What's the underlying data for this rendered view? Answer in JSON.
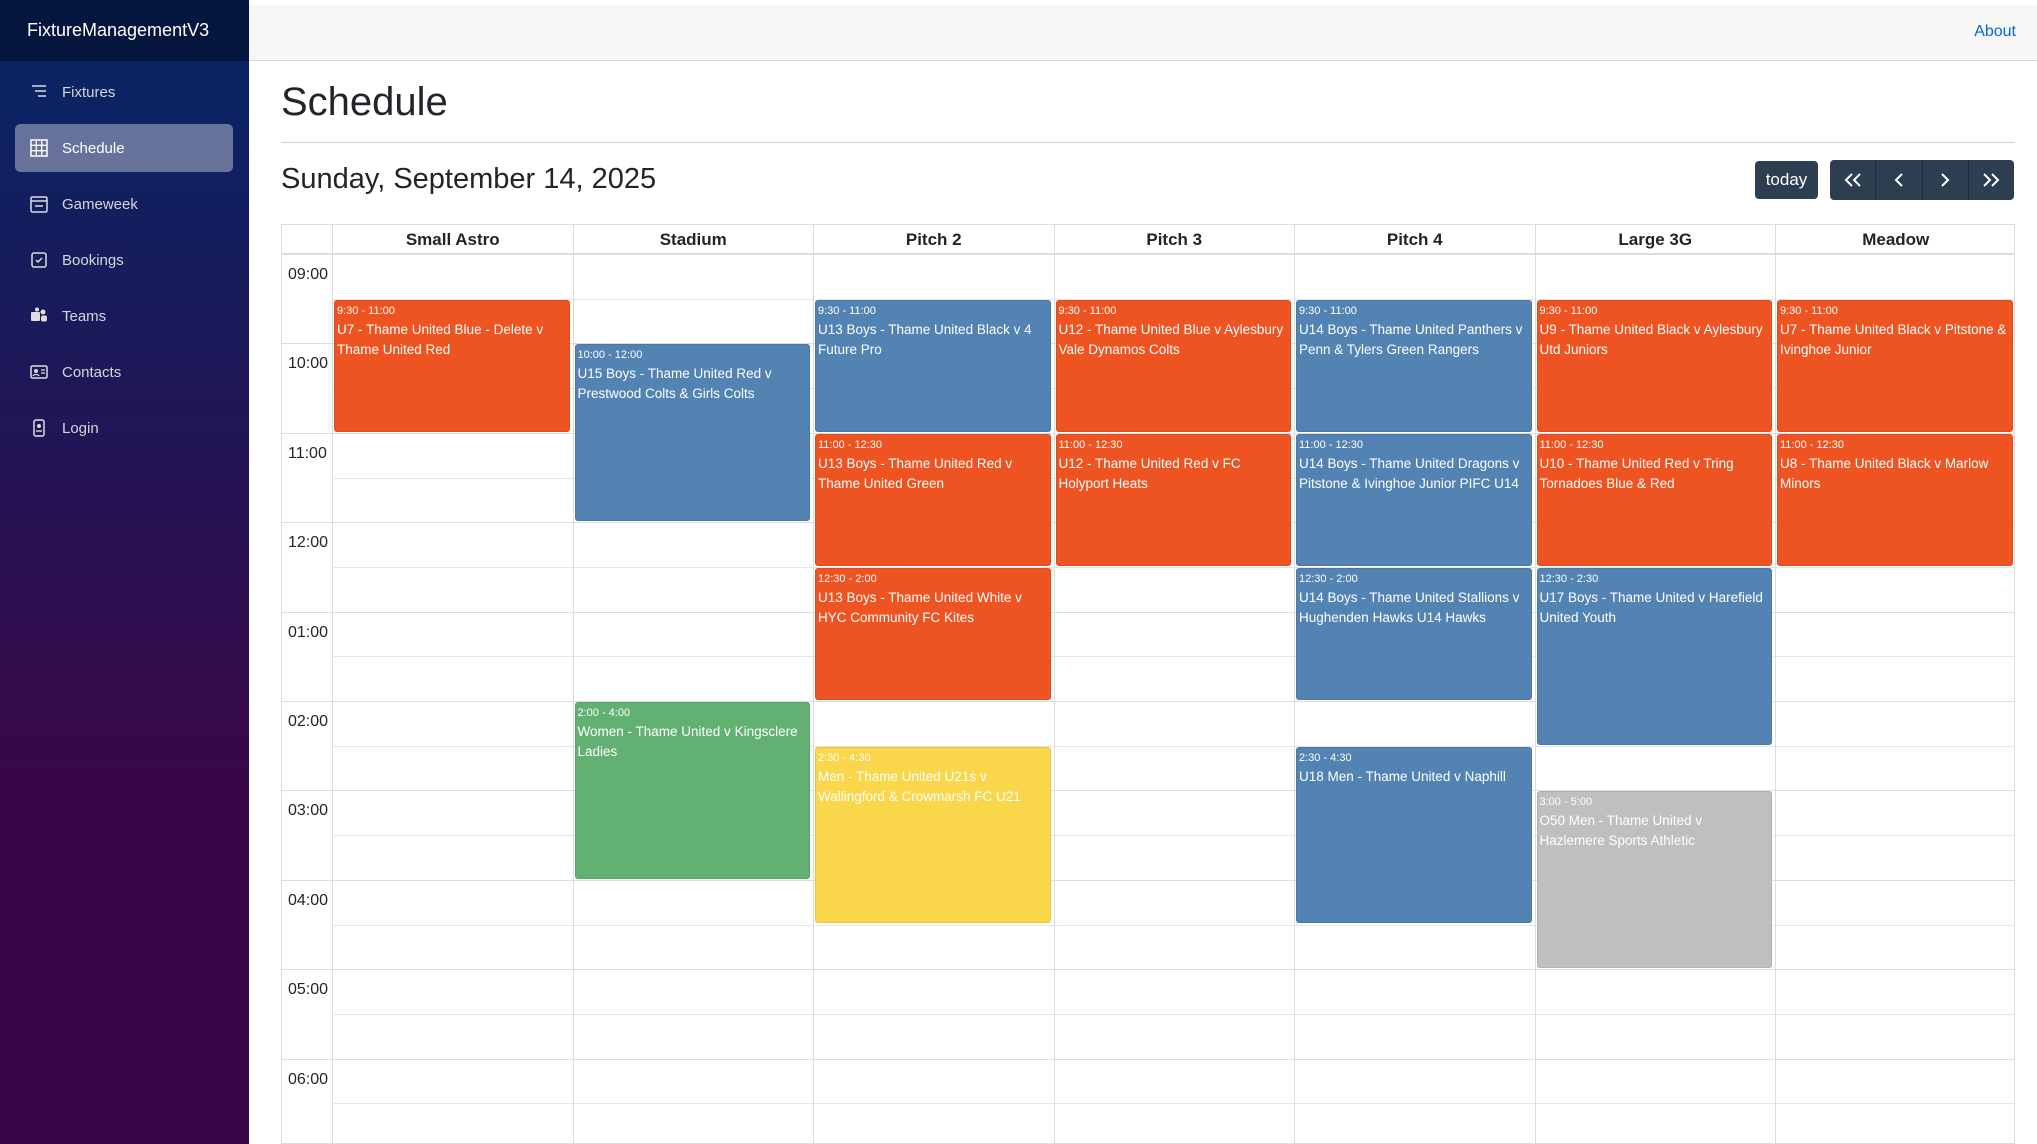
{
  "app": {
    "brand": "FixtureManagementV3"
  },
  "topbar": {
    "about_label": "About"
  },
  "sidebar": {
    "items": [
      {
        "label": "Fixtures",
        "icon": "list-icon"
      },
      {
        "label": "Schedule",
        "icon": "grid-icon",
        "active": true
      },
      {
        "label": "Gameweek",
        "icon": "calendar-check-icon"
      },
      {
        "label": "Bookings",
        "icon": "checkbox-icon"
      },
      {
        "label": "Teams",
        "icon": "teams-icon"
      },
      {
        "label": "Contacts",
        "icon": "contact-card-icon"
      },
      {
        "label": "Login",
        "icon": "login-icon"
      }
    ]
  },
  "page": {
    "title": "Schedule",
    "date": "Sunday, September 14, 2025"
  },
  "toolbar": {
    "today_label": "today",
    "prev_prev": "«",
    "prev": "‹",
    "next": "›",
    "next_next": "»"
  },
  "calendar": {
    "resources": [
      "Small Astro",
      "Stadium",
      "Pitch 2",
      "Pitch 3",
      "Pitch 4",
      "Large 3G",
      "Meadow"
    ],
    "time_labels": [
      "09:00",
      "10:00",
      "11:00",
      "12:00",
      "01:00",
      "02:00",
      "03:00",
      "04:00",
      "05:00",
      "06:00"
    ],
    "colors": {
      "orange": "#ee5422",
      "blue": "#5383b3",
      "green": "#62b173",
      "yellow": "#f9d64a",
      "grey": "#bfbfbf"
    },
    "events": [
      {
        "resource": 0,
        "start": 9.5,
        "end": 11.0,
        "color": "orange",
        "time": "9:30 - 11:00",
        "title": "U7 - Thame United Blue - Delete v Thame United Red"
      },
      {
        "resource": 1,
        "start": 10.0,
        "end": 12.0,
        "color": "blue",
        "time": "10:00 - 12:00",
        "title": "U15 Boys - Thame United Red v Prestwood Colts & Girls Colts"
      },
      {
        "resource": 1,
        "start": 14.0,
        "end": 16.0,
        "color": "green",
        "time": "2:00 - 4:00",
        "title": "Women - Thame United v Kingsclere Ladies"
      },
      {
        "resource": 2,
        "start": 9.5,
        "end": 11.0,
        "color": "blue",
        "time": "9:30 - 11:00",
        "title": "U13 Boys - Thame United Black v 4 Future Pro"
      },
      {
        "resource": 2,
        "start": 11.0,
        "end": 12.5,
        "color": "orange",
        "time": "11:00 - 12:30",
        "title": "U13 Boys - Thame United Red v Thame United Green"
      },
      {
        "resource": 2,
        "start": 12.5,
        "end": 14.0,
        "color": "orange",
        "time": "12:30 - 2:00",
        "title": "U13 Boys - Thame United White v HYC Community FC Kites"
      },
      {
        "resource": 2,
        "start": 14.5,
        "end": 16.5,
        "color": "yellow",
        "time": "2:30 - 4:30",
        "title": "Men - Thame United U21s v Wallingford & Crowmarsh FC U21"
      },
      {
        "resource": 3,
        "start": 9.5,
        "end": 11.0,
        "color": "orange",
        "time": "9:30 - 11:00",
        "title": "U12 - Thame United Blue v Aylesbury Vale Dynamos Colts"
      },
      {
        "resource": 3,
        "start": 11.0,
        "end": 12.5,
        "color": "orange",
        "time": "11:00 - 12:30",
        "title": "U12 - Thame United Red v FC Holyport Heats"
      },
      {
        "resource": 4,
        "start": 9.5,
        "end": 11.0,
        "color": "blue",
        "time": "9:30 - 11:00",
        "title": "U14 Boys - Thame United Panthers v Penn & Tylers Green Rangers"
      },
      {
        "resource": 4,
        "start": 11.0,
        "end": 12.5,
        "color": "blue",
        "time": "11:00 - 12:30",
        "title": "U14 Boys - Thame United Dragons v Pitstone & Ivinghoe Junior PIFC U14"
      },
      {
        "resource": 4,
        "start": 12.5,
        "end": 14.0,
        "color": "blue",
        "time": "12:30 - 2:00",
        "title": "U14 Boys - Thame United Stallions v Hughenden Hawks U14 Hawks"
      },
      {
        "resource": 4,
        "start": 14.5,
        "end": 16.5,
        "color": "blue",
        "time": "2:30 - 4:30",
        "title": "U18 Men - Thame United v Naphill"
      },
      {
        "resource": 5,
        "start": 9.5,
        "end": 11.0,
        "color": "orange",
        "time": "9:30 - 11:00",
        "title": "U9 - Thame United Black v Aylesbury Utd Juniors"
      },
      {
        "resource": 5,
        "start": 11.0,
        "end": 12.5,
        "color": "orange",
        "time": "11:00 - 12:30",
        "title": "U10 - Thame United Red v Tring Tornadoes Blue & Red"
      },
      {
        "resource": 5,
        "start": 12.5,
        "end": 14.5,
        "color": "blue",
        "time": "12:30 - 2:30",
        "title": "U17 Boys - Thame United v Harefield United Youth"
      },
      {
        "resource": 5,
        "start": 15.0,
        "end": 17.0,
        "color": "grey",
        "time": "3:00 - 5:00",
        "title": "O50 Men - Thame United v Hazlemere Sports Athletic"
      },
      {
        "resource": 6,
        "start": 9.5,
        "end": 11.0,
        "color": "orange",
        "time": "9:30 - 11:00",
        "title": "U7 - Thame United Black v Pitstone & Ivinghoe Junior"
      },
      {
        "resource": 6,
        "start": 11.0,
        "end": 12.5,
        "color": "orange",
        "time": "11:00 - 12:30",
        "title": "U8 - Thame United Black v Marlow Minors"
      }
    ]
  }
}
